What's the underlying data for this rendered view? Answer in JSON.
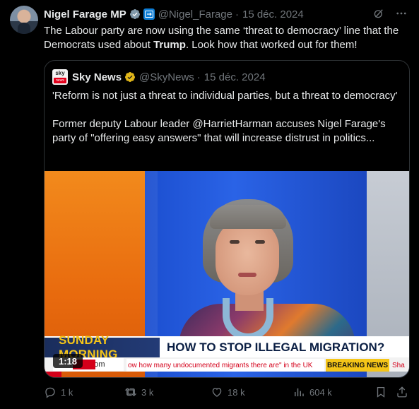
{
  "post": {
    "author_name": "Nigel Farage MP",
    "handle": "@Nigel_Farage",
    "separator": "·",
    "date": "15 déc. 2024",
    "text_part1": "The Labour party are now using the same ‘threat to democracy’ line that the Democrats used about ",
    "text_bold": "Trump",
    "text_part2": ". Look how that worked out for them!"
  },
  "quote": {
    "logo_top": "sky",
    "logo_bottom": "news",
    "author_name": "Sky News",
    "handle": "@SkyNews",
    "separator": "·",
    "date": "15 déc. 2024",
    "paragraph1": "'Reform is not just a threat to individual parties, but a threat to democracy'",
    "paragraph2": "Former deputy Labour leader @HarrietHarman accuses Nigel Farage's party of \"offering easy answers\" that will increase distrust in politics...",
    "video": {
      "duration": "1:18",
      "lower_third_left": "SUNDAY MORNING",
      "lower_third_right": "HOW TO STOP ILLEGAL MIGRATION?",
      "ticker_logo": "news.com",
      "ticker_text": "ow how many undocumented migrants there are\" in the UK",
      "ticker_breaking": "BREAKING NEWS",
      "ticker_tail": "Sha"
    }
  },
  "actions": {
    "replies": "1 k",
    "reposts": "3 k",
    "likes": "18 k",
    "views": "604 k"
  },
  "colors": {
    "background": "#000000",
    "text": "#e7e9ea",
    "secondary": "#71767b",
    "verified_blue": "#1d9bf0",
    "verified_gold": "#e2b719",
    "border": "#2f3336"
  }
}
